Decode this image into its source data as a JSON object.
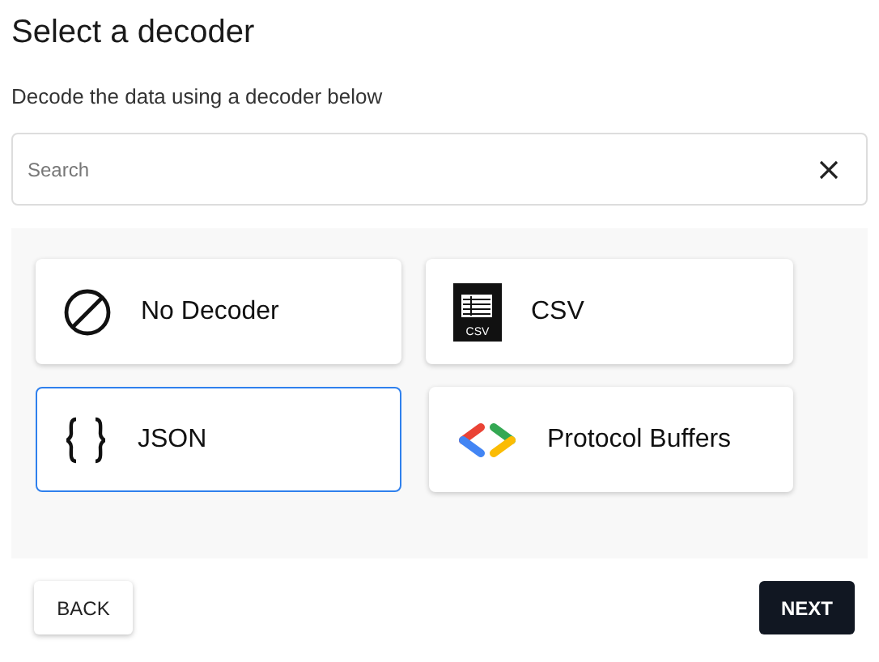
{
  "title": "Select a decoder",
  "subtitle": "Decode the data using a decoder below",
  "search": {
    "placeholder": "Search"
  },
  "decoders": [
    {
      "kind": "none",
      "label": "No Decoder",
      "selected": false
    },
    {
      "kind": "csv",
      "label": "CSV",
      "icon_text": "CSV",
      "selected": false
    },
    {
      "kind": "json",
      "label": "JSON",
      "selected": true
    },
    {
      "kind": "protobuf",
      "label": "Protocol Buffers",
      "selected": false
    }
  ],
  "buttons": {
    "back": "BACK",
    "next": "NEXT"
  }
}
